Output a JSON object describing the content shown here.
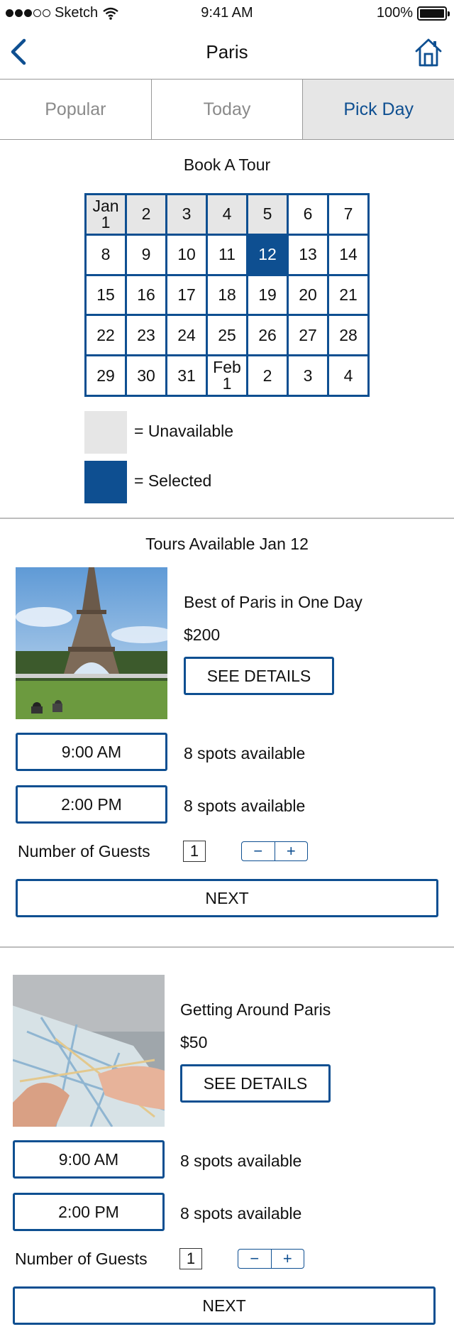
{
  "status_bar": {
    "carrier": "Sketch",
    "time": "9:41 AM",
    "battery": "100%"
  },
  "nav": {
    "title": "Paris",
    "back_icon": "chevron-left-icon",
    "home_icon": "home-icon"
  },
  "tabs": [
    {
      "label": "Popular",
      "active": false
    },
    {
      "label": "Today",
      "active": false
    },
    {
      "label": "Pick Day",
      "active": true
    }
  ],
  "booking": {
    "title": "Book A Tour",
    "calendar": [
      {
        "label": "Jan\n1",
        "state": "unavailable"
      },
      {
        "label": "2",
        "state": "unavailable"
      },
      {
        "label": "3",
        "state": "unavailable"
      },
      {
        "label": "4",
        "state": "unavailable"
      },
      {
        "label": "5",
        "state": "unavailable"
      },
      {
        "label": "6",
        "state": "available"
      },
      {
        "label": "7",
        "state": "available"
      },
      {
        "label": "8",
        "state": "available"
      },
      {
        "label": "9",
        "state": "available"
      },
      {
        "label": "10",
        "state": "available"
      },
      {
        "label": "11",
        "state": "available"
      },
      {
        "label": "12",
        "state": "selected"
      },
      {
        "label": "13",
        "state": "available"
      },
      {
        "label": "14",
        "state": "available"
      },
      {
        "label": "15",
        "state": "available"
      },
      {
        "label": "16",
        "state": "available"
      },
      {
        "label": "17",
        "state": "available"
      },
      {
        "label": "18",
        "state": "available"
      },
      {
        "label": "19",
        "state": "available"
      },
      {
        "label": "20",
        "state": "available"
      },
      {
        "label": "21",
        "state": "available"
      },
      {
        "label": "22",
        "state": "available"
      },
      {
        "label": "23",
        "state": "available"
      },
      {
        "label": "24",
        "state": "available"
      },
      {
        "label": "25",
        "state": "available"
      },
      {
        "label": "26",
        "state": "available"
      },
      {
        "label": "27",
        "state": "available"
      },
      {
        "label": "28",
        "state": "available"
      },
      {
        "label": "29",
        "state": "available"
      },
      {
        "label": "30",
        "state": "available"
      },
      {
        "label": "31",
        "state": "available"
      },
      {
        "label": "Feb\n1",
        "state": "available"
      },
      {
        "label": "2",
        "state": "available"
      },
      {
        "label": "3",
        "state": "available"
      },
      {
        "label": "4",
        "state": "available"
      }
    ],
    "legend": {
      "unavailable": "= Unavailable",
      "selected": "= Selected"
    }
  },
  "tours_title": "Tours Available Jan 12",
  "tours": [
    {
      "name": "Best of Paris in One Day",
      "price": "$200",
      "details_label": "SEE DETAILS",
      "photo": "eiffel-tower-photo",
      "slots": [
        {
          "time": "9:00 AM",
          "spots": "8 spots available"
        },
        {
          "time": "2:00 PM",
          "spots": "8 spots available"
        }
      ],
      "guests_label": "Number of Guests",
      "guests_value": "1",
      "minus": "−",
      "plus": "+",
      "next_label": "NEXT"
    },
    {
      "name": "Getting Around Paris",
      "price": "$50",
      "details_label": "SEE DETAILS",
      "photo": "map-in-hand-photo",
      "slots": [
        {
          "time": "9:00 AM",
          "spots": "8 spots available"
        },
        {
          "time": "2:00 PM",
          "spots": "8 spots available"
        }
      ],
      "guests_label": "Number of Guests",
      "guests_value": "1",
      "minus": "−",
      "plus": "+",
      "next_label": "NEXT"
    }
  ],
  "colors": {
    "accent": "#0e4f91",
    "unavailable": "#e6e6e6",
    "divider": "#bdbdbd"
  }
}
